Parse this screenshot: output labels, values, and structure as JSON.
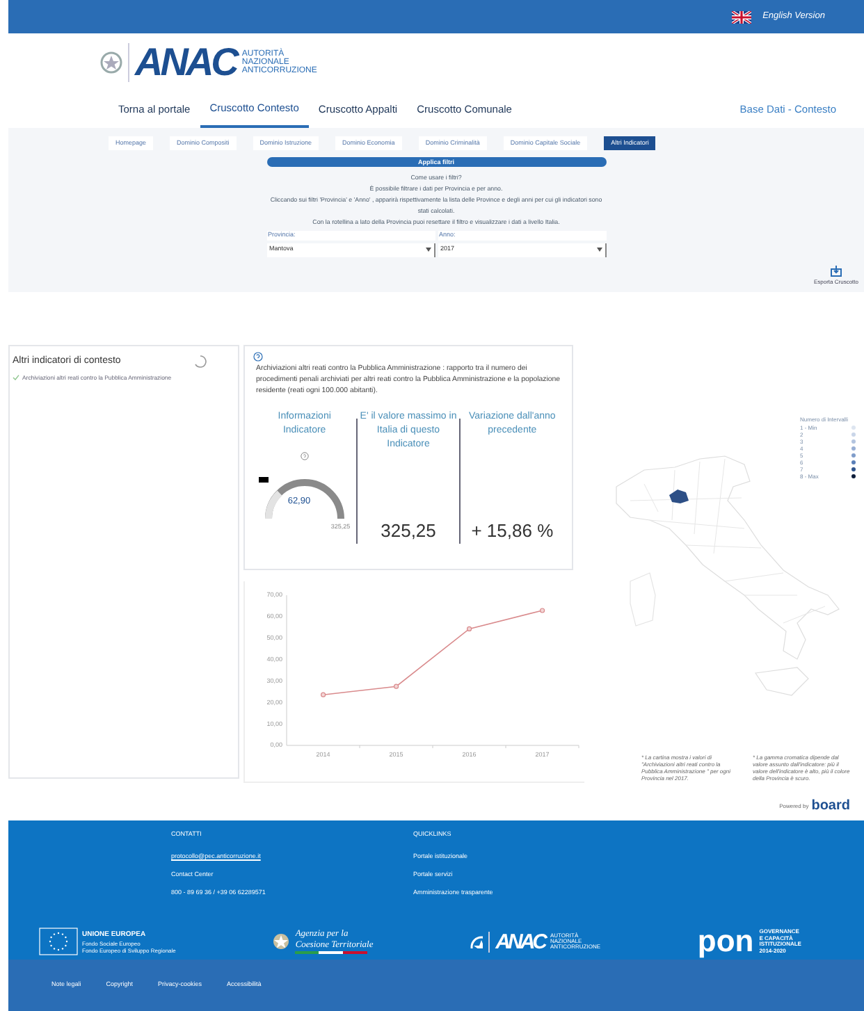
{
  "top_bar": {
    "language_link": "English Version"
  },
  "logo": {
    "mark": "ANAC",
    "lines": [
      "AUTORITÀ",
      "NAZIONALE",
      "ANTICORRUZIONE"
    ]
  },
  "nav": {
    "tabs": [
      {
        "label": "Torna al portale",
        "selected": false
      },
      {
        "label": "Cruscotto Contesto",
        "selected": true
      },
      {
        "label": "Cruscotto Appalti",
        "selected": false
      },
      {
        "label": "Cruscotto Comunale",
        "selected": false
      }
    ],
    "right_label": "Base Dati - Contesto"
  },
  "subtabs": [
    {
      "label": "Homepage",
      "selected": false
    },
    {
      "label": "Dominio Compositi",
      "selected": false
    },
    {
      "label": "Dominio Istruzione",
      "selected": false
    },
    {
      "label": "Dominio Economia",
      "selected": false
    },
    {
      "label": "Dominio Criminalità",
      "selected": false
    },
    {
      "label": "Dominio Capitale Sociale",
      "selected": false
    },
    {
      "label": "Altri Indicatori",
      "selected": true
    }
  ],
  "filters": {
    "apply_button": "Applica filtri",
    "help_lines": [
      "Come usare i filtri?",
      "È possibile filtrare i dati per Provincia e per anno.",
      "Cliccando sui filtri 'Provincia' e 'Anno' , apparirà rispettivamente la lista delle Province e degli anni per cui gli indicatori sono stati calcolati.",
      "Con la rotellina a lato della Provincia puoi resettare il filtro e visualizzare i dati a livello Italia."
    ],
    "fields": [
      {
        "label": "Provincia:",
        "value": "Mantova"
      },
      {
        "label": "Anno:",
        "value": "2017"
      }
    ],
    "export_button": "Esporta Cruscotto"
  },
  "sidebar": {
    "title": "Altri indicatori di contesto",
    "items": [
      {
        "label": "Archiviazioni altri reati contro la Pubblica Amministrazione",
        "checked": true
      }
    ]
  },
  "indicator_card": {
    "description": "Archiviazioni altri reati contro la Pubblica Amministrazione : rapporto tra il numero dei procedimenti penali archiviati per altri reati contro la Pubblica Amministrazione e la popolazione residente (reati ogni 100.000 abitanti).",
    "columns": [
      {
        "kind": "gauge",
        "header": "Informazioni Indicatore",
        "value": "62,90",
        "max_label": "325,25"
      },
      {
        "kind": "number",
        "header": "E' il valore massimo in Italia di questo Indicatore",
        "value": "325,25"
      },
      {
        "kind": "number",
        "header": "Variazione dall'anno precedente",
        "value": "+ 15,86 %"
      }
    ]
  },
  "trend_chart": {
    "chart_data": {
      "type": "line",
      "categories": [
        "2014",
        "2015",
        "2016",
        "2017"
      ],
      "series": [
        {
          "color": "#d98a8c",
          "marker": "circle",
          "values": [
            23.6,
            27.5,
            54.3,
            62.9
          ]
        }
      ],
      "ylim": [
        0,
        70
      ],
      "yticks": [
        {
          "value": 0,
          "label": "0,00"
        },
        {
          "value": 10,
          "label": "10,00"
        },
        {
          "value": 20,
          "label": "20,00"
        },
        {
          "value": 30,
          "label": "30,00"
        },
        {
          "value": 40,
          "label": "40,00"
        },
        {
          "value": 50,
          "label": "50,00"
        },
        {
          "value": 60,
          "label": "60,00"
        },
        {
          "value": 70,
          "label": "70,00"
        }
      ]
    }
  },
  "map_legend": {
    "title": "Numero di Intervalli",
    "items": [
      {
        "label": "1 - Min",
        "color": "#dde5f0"
      },
      {
        "label": "2",
        "color": "#cad6e9"
      },
      {
        "label": "3",
        "color": "#b3c4df"
      },
      {
        "label": "4",
        "color": "#98afd5"
      },
      {
        "label": "5",
        "color": "#809dca"
      },
      {
        "label": "6",
        "color": "#5a7fb8"
      },
      {
        "label": "7",
        "color": "#30548c"
      },
      {
        "label": "8 - Max",
        "color": "#0e1d3a"
      }
    ]
  },
  "notes": [
    "* La cartina mostra i valori di \"Archiviazioni altri reati contro la Pubblica Amministrazione \" per ogni Provincia nel 2017.",
    "* La gamma cromatica dipende dal valore assunto dall'indicatore: più il valore dell'indicatore è alto, più il colore della Provincia è scuro."
  ],
  "powered_by": {
    "label": "Powered by",
    "brand": "board"
  },
  "footer": {
    "columns": [
      {
        "title": "CONTATTI",
        "links": [
          "protocollo@pec.anticorruzione.it",
          "Contact Center",
          "800 - 89 69 36 / +39 06 62289571"
        ]
      },
      {
        "title": "QUICKLINKS",
        "links": [
          "Portale istituzionale",
          "Portale servizi",
          "Amministrazione trasparente"
        ]
      }
    ],
    "eu": {
      "title": "UNIONE EUROPEA",
      "lines": [
        "Fondo Sociale Europeo",
        "Fondo Europeo di Sviluppo Regionale"
      ]
    },
    "agency": [
      "Agenzia per la",
      "Coesione Territoriale"
    ],
    "anac": {
      "mark": "ANAC",
      "lines": [
        "AUTORITÀ",
        "NAZIONALE",
        "ANTICORRUZIONE"
      ]
    },
    "pon": {
      "mark": "pon",
      "lines": [
        "GOVERNANCE",
        "E CAPACITÀ",
        "ISTITUZIONALE",
        "2014-2020"
      ]
    },
    "bottom_links": [
      "Note legali",
      "Copyright",
      "Privacy-cookies",
      "Accessibilità"
    ]
  }
}
